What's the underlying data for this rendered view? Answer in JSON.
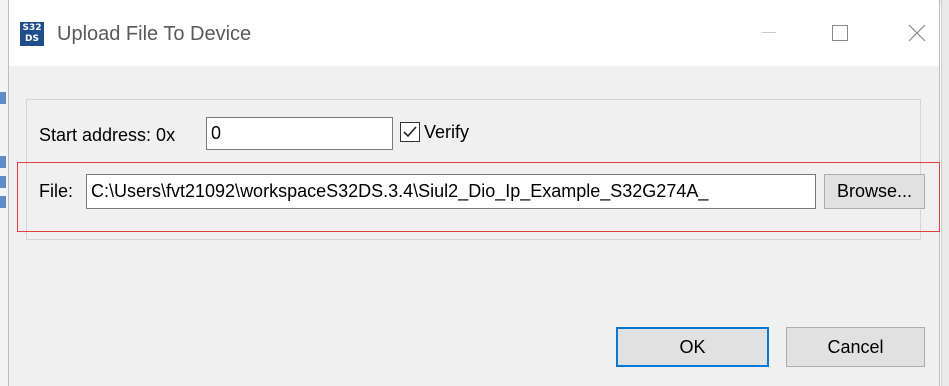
{
  "window": {
    "title": "Upload File To Device",
    "app_icon_text_top": "S32",
    "app_icon_text_bottom": "DS",
    "app_icon_color": "#1f4e8c"
  },
  "form": {
    "start_address_label": "Start address: 0x",
    "start_address_value": "0",
    "verify_label": "Verify",
    "verify_checked": true,
    "file_label": "File:",
    "file_value": "C:\\Users\\fvt21092\\workspaceS32DS.3.4\\Siul2_Dio_Ip_Example_S32G274A_",
    "browse_label": "Browse..."
  },
  "buttons": {
    "ok_label": "OK",
    "cancel_label": "Cancel"
  },
  "colors": {
    "dialog_bg": "#f0f0f0",
    "highlight": "#e04040",
    "default_button_border": "#0078d7"
  }
}
